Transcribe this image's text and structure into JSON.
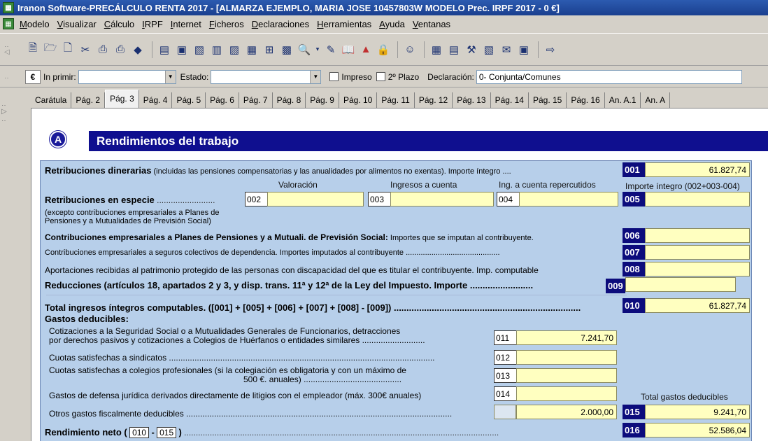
{
  "window": {
    "title": "Iranon Software-PRECÁLCULO RENTA 2017 - [ALMARZA EJEMPLO, MARIA JOSE 10457803W  MODELO Prec. IRPF  2017 - 0 €]"
  },
  "menu": [
    "Modelo",
    "Visualizar",
    "Cálculo",
    "IRPF",
    "Internet",
    "Ficheros",
    "Declaraciones",
    "Herramientas",
    "Ayuda",
    "Ventanas"
  ],
  "toolbar": {
    "icons": [
      "new-icon",
      "open-icon",
      "page-icon",
      "cut-icon",
      "print-icon",
      "print2-icon",
      "diamond-icon",
      "doc-a-icon",
      "doc-b-icon",
      "doc-c-icon",
      "doc-d-icon",
      "doc-e-icon",
      "doc-f-icon",
      "table-icon",
      "doc-g-icon",
      "search-icon",
      "edit-icon",
      "book-icon",
      "chart-icon",
      "lock-icon",
      "user-icon",
      "calc-icon",
      "doc-h-icon",
      "tool-a-icon",
      "tool-b-icon",
      "tool-c-icon",
      "tool-d-icon",
      "exit-icon"
    ]
  },
  "filters": {
    "currency": "€",
    "in_primir_label": "In primir:",
    "in_primir_value": "",
    "estado_label": "Estado:",
    "estado_value": "",
    "impreso_label": "Impreso",
    "plazo_label": "2º Plazo",
    "declaracion_label": "Declaración:",
    "declaracion_value": "0- Conjunta/Comunes"
  },
  "tabs": [
    "Carátula",
    "Pág. 2",
    "Pág. 3",
    "Pág. 4",
    "Pág. 5",
    "Pág. 6",
    "Pág. 7",
    "Pág. 8",
    "Pág. 9",
    "Pág. 10",
    "Pág. 11",
    "Pág. 12",
    "Pág. 13",
    "Pág. 14",
    "Pág. 15",
    "Pág. 16",
    "An. A.1",
    "An. A"
  ],
  "active_tab": "Pág. 3",
  "section": {
    "letter": "A",
    "title": "Rendimientos del trabajo"
  },
  "form": {
    "r001": {
      "label": "Retribuciones dinerarias",
      "note": " (incluidas las pensiones compensatorias y las anualidades por alimentos no exentas). Importe íntegro ....",
      "code": "001",
      "value": "61.827,74"
    },
    "col_valoracion": "Valoración",
    "col_ingresos": "Ingresos a cuenta",
    "col_repercutidos": "Ing. a cuenta repercutidos",
    "col_importe": "Importe íntegro (002+003-004)",
    "especie": {
      "label": "Retribuciones en especie",
      "dots": " .........................",
      "c002": "002",
      "v002": "",
      "c003": "003",
      "v003": "",
      "c004": "004",
      "v004": "",
      "c005": "005",
      "v005": "",
      "note1": "(excepto contribuciones empresariales a Planes de",
      "note2": "Pensiones y a Mutualidades de Previsión Social)"
    },
    "r006": {
      "label": "Contribuciones empresariales a Planes de Pensiones y a Mutuali. de Previsión Social:",
      "note": " Importes que se imputan al contribuyente.",
      "code": "006",
      "value": ""
    },
    "r007": {
      "label": "Contribuciones empresariales a seguros colectivos de dependencia. Importes imputados al contribuyente ............................................",
      "code": "007",
      "value": ""
    },
    "r008": {
      "label": "Aportaciones recibidas al patrimonio protegido de las personas con discapacidad del que es titular el contribuyente. Imp. computable",
      "code": "008",
      "value": ""
    },
    "r009": {
      "label": "Reducciones (artículos 18, apartados 2 y 3, y disp. trans. 11ª y 12ª de la Ley del Impuesto. Importe .........................",
      "code": "009",
      "value": ""
    },
    "r010": {
      "label": "Total ingresos íntegros computables. ([001] + [005] + [006] + [007] + [008] - [009]) ..........................................................................",
      "code": "010",
      "value": "61.827,74"
    },
    "gastos_title": "Gastos deducibles:",
    "r011": {
      "line1": "Cotizaciones a la Seguridad Social o a Mutualidades Generales de Funcionarios, detracciones",
      "line2": "por derechos pasivos y cotizaciones a Colegios de Huérfanos o entidades similares ...........................",
      "code": "011",
      "value": "7.241,70"
    },
    "r012": {
      "label": "Cuotas satisfechas a sindicatos ..................................................................................................................",
      "code": "012",
      "value": ""
    },
    "r013": {
      "line1": "Cuotas satisfechas a colegios profesionales   (si la colegiación es obligatoria y con un máximo de",
      "line2": "500 €. anuales) ..........................................",
      "code": "013",
      "value": ""
    },
    "r014": {
      "label": "Gastos de defensa jurídica derivados directamente de litigios con el empleador (máx. 300€ anuales)",
      "code": "014",
      "value": ""
    },
    "total_gastos_label": "Total gastos deducibles",
    "r015": {
      "label": "Otros gastos fiscalmente deducibles ..................................................................................................................",
      "value_in": "2.000,00",
      "code": "015",
      "value": "9.241,70"
    },
    "r016": {
      "label": "Rendimiento neto (",
      "ref1": "010",
      "sep": "-",
      "ref2": "015",
      "close": ")",
      "dots": " .......................................................................................................................................",
      "code": "016",
      "value": "52.586,04"
    }
  }
}
